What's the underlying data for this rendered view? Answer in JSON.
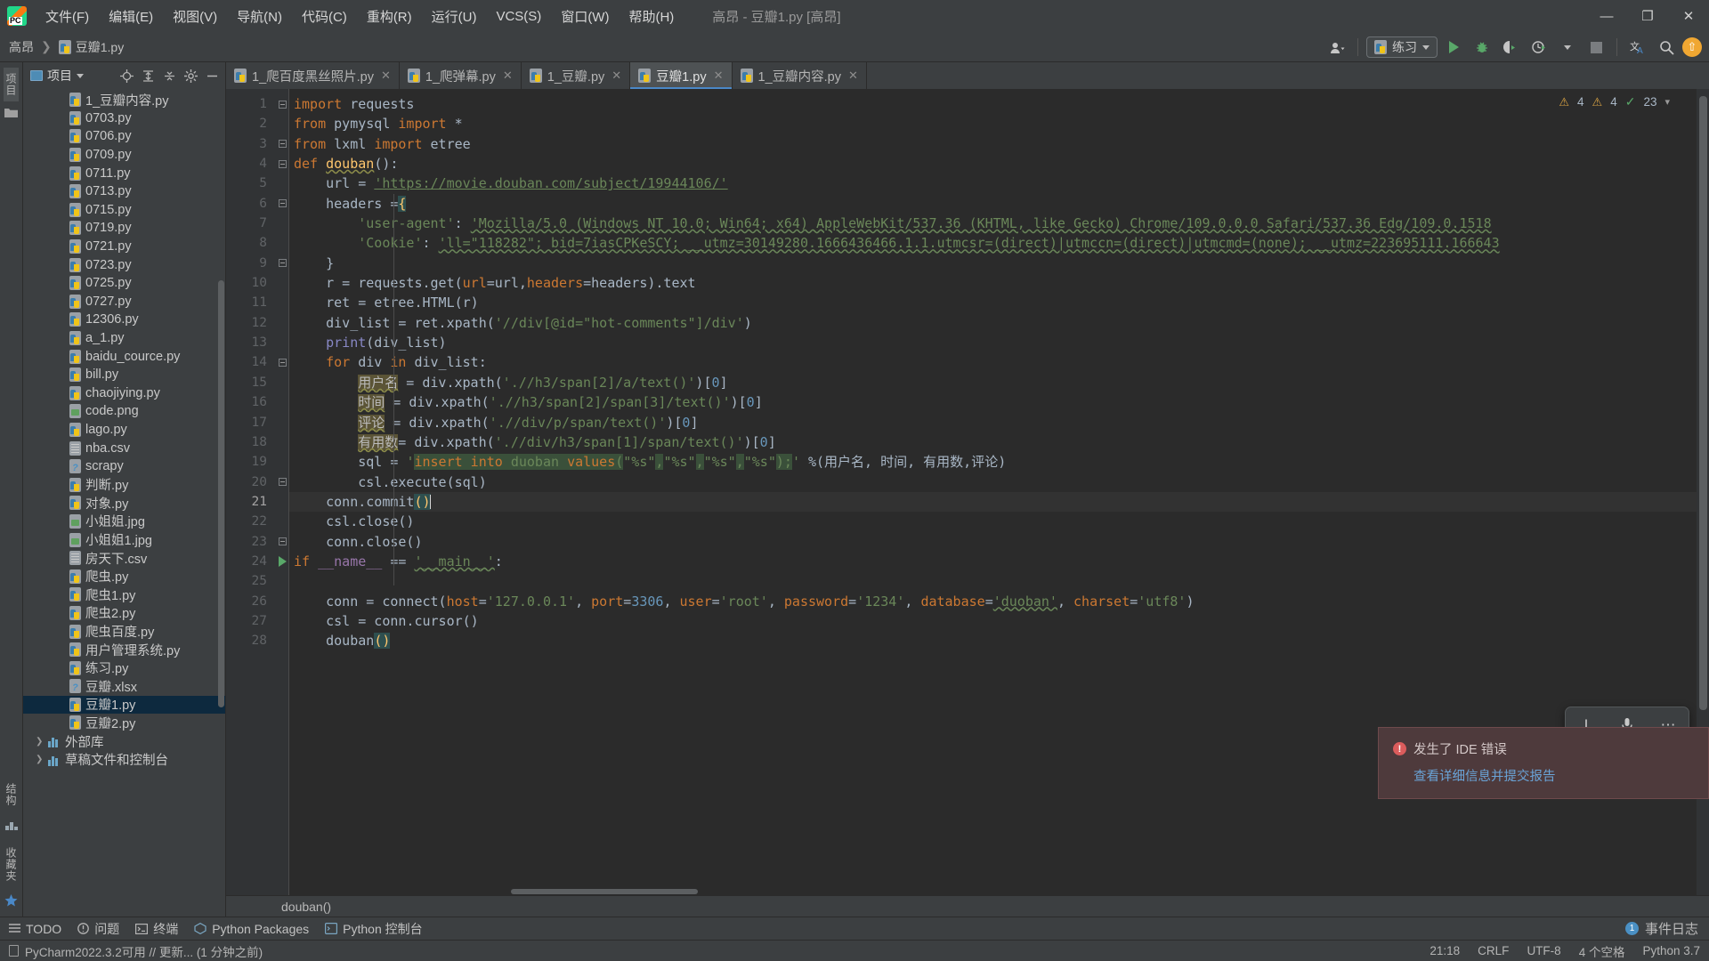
{
  "menu": {
    "items": [
      "文件(F)",
      "编辑(E)",
      "视图(V)",
      "导航(N)",
      "代码(C)",
      "重构(R)",
      "运行(U)",
      "VCS(S)",
      "窗口(W)",
      "帮助(H)"
    ],
    "window_title": "高昂 - 豆瓣1.py [高昂]",
    "controls": {
      "minimize": "—",
      "maximize": "❐",
      "close": "✕"
    }
  },
  "navbar": {
    "breadcrumb": {
      "project": "高昂",
      "file": "豆瓣1.py"
    },
    "run_config": "练习",
    "icons": {
      "account": "account-icon",
      "run": "run-icon",
      "debug": "debug-icon",
      "coverage": "coverage-icon",
      "profile": "profile-icon",
      "stop": "stop-icon",
      "translate": "translate-icon",
      "search": "search-icon",
      "update": "update-icon"
    }
  },
  "leftstrip": {
    "top_label": "项目",
    "bottom_labels": [
      "结构",
      "收藏夹"
    ]
  },
  "project_panel": {
    "title": "项目",
    "tools": [
      "locate-icon",
      "expand-icon",
      "collapse-icon",
      "settings-icon",
      "hide-icon"
    ],
    "tree": [
      {
        "label": "1_豆瓣内容.py",
        "type": "py",
        "selected": false
      },
      {
        "label": "0703.py",
        "type": "py",
        "selected": false
      },
      {
        "label": "0706.py",
        "type": "py",
        "selected": false
      },
      {
        "label": "0709.py",
        "type": "py",
        "selected": false
      },
      {
        "label": "0711.py",
        "type": "py",
        "selected": false
      },
      {
        "label": "0713.py",
        "type": "py",
        "selected": false
      },
      {
        "label": "0715.py",
        "type": "py",
        "selected": false
      },
      {
        "label": "0719.py",
        "type": "py",
        "selected": false
      },
      {
        "label": "0721.py",
        "type": "py",
        "selected": false
      },
      {
        "label": "0723.py",
        "type": "py",
        "selected": false
      },
      {
        "label": "0725.py",
        "type": "py",
        "selected": false
      },
      {
        "label": "0727.py",
        "type": "py",
        "selected": false
      },
      {
        "label": "12306.py",
        "type": "py",
        "selected": false
      },
      {
        "label": "a_1.py",
        "type": "py",
        "selected": false
      },
      {
        "label": "baidu_cource.py",
        "type": "py",
        "selected": false
      },
      {
        "label": "bill.py",
        "type": "py",
        "selected": false
      },
      {
        "label": "chaojiying.py",
        "type": "py",
        "selected": false
      },
      {
        "label": "code.png",
        "type": "img",
        "selected": false
      },
      {
        "label": "lago.py",
        "type": "py",
        "selected": false
      },
      {
        "label": "nba.csv",
        "type": "csv",
        "selected": false
      },
      {
        "label": "scrapy",
        "type": "unknown",
        "selected": false
      },
      {
        "label": "判断.py",
        "type": "py",
        "selected": false
      },
      {
        "label": "对象.py",
        "type": "py",
        "selected": false
      },
      {
        "label": "小姐姐.jpg",
        "type": "img",
        "selected": false
      },
      {
        "label": "小姐姐1.jpg",
        "type": "img",
        "selected": false
      },
      {
        "label": "房天下.csv",
        "type": "csv",
        "selected": false
      },
      {
        "label": "爬虫.py",
        "type": "py",
        "selected": false
      },
      {
        "label": "爬虫1.py",
        "type": "py",
        "selected": false
      },
      {
        "label": "爬虫2.py",
        "type": "py",
        "selected": false
      },
      {
        "label": "爬虫百度.py",
        "type": "py",
        "selected": false
      },
      {
        "label": "用户管理系统.py",
        "type": "py",
        "selected": false
      },
      {
        "label": "练习.py",
        "type": "py",
        "selected": false
      },
      {
        "label": "豆瓣.xlsx",
        "type": "unknown",
        "selected": false
      },
      {
        "label": "豆瓣1.py",
        "type": "py",
        "selected": true
      },
      {
        "label": "豆瓣2.py",
        "type": "py",
        "selected": false
      }
    ],
    "roots": [
      {
        "label": "外部库",
        "type": "lib"
      },
      {
        "label": "草稿文件和控制台",
        "type": "lib"
      }
    ]
  },
  "editor_tabs": [
    {
      "label": "1_爬百度黑丝照片.py",
      "active": false
    },
    {
      "label": "1_爬弹幕.py",
      "active": false
    },
    {
      "label": "1_豆瓣.py",
      "active": false
    },
    {
      "label": "豆瓣1.py",
      "active": true
    },
    {
      "label": "1_豆瓣内容.py",
      "active": false
    }
  ],
  "inspection": {
    "warnings_top": "4",
    "warnings_weak": "4",
    "checks": "23"
  },
  "code": {
    "line_count": 28,
    "current_line": 21,
    "lines": [
      "import requests",
      "from pymysql import *",
      "from lxml import etree",
      "def douban():",
      "    url = 'https://movie.douban.com/subject/19944106/'",
      "    headers ={",
      "        'user-agent': 'Mozilla/5.0 (Windows NT 10.0; Win64; x64) AppleWebKit/537.36 (KHTML, like Gecko) Chrome/109.0.0.0 Safari/537.36 Edg/109.0.1518",
      "        'Cookie': 'll=\"118282\"; bid=7iasCPKeSCY; __utmz=30149280.1666436466.1.1.utmcsr=(direct)|utmccn=(direct)|utmcmd=(none); __utmz=223695111.166643",
      "    }",
      "    r = requests.get(url=url,headers=headers).text",
      "    ret = etree.HTML(r)",
      "    div_list = ret.xpath('//div[@id=\"hot-comments\"]/div')",
      "    print(div_list)",
      "    for div in div_list:",
      "        用户名 = div.xpath('.//h3/span[2]/a/text()')[0]",
      "        时间 = div.xpath('.//h3/span[2]/span[3]/text()')[0]",
      "        评论 = div.xpath('.//div/p/span/text()')[0]",
      "        有用数= div.xpath('.//div/h3/span[1]/span/text()')[0]",
      "        sql = 'insert into duoban values(\"%s\",\"%s\",\"%s\",\"%s\");' %(用户名, 时间, 有用数,评论)",
      "        csl.execute(sql)",
      "    conn.commit()",
      "    csl.close()",
      "    conn.close()",
      "if __name__ == '__main__':",
      "",
      "    conn = connect(host='127.0.0.1', port=3306, user='root', password='1234', database='duoban', charset='utf8')",
      "    csl = conn.cursor()",
      "    douban()"
    ]
  },
  "editor_breadcrumb": "douban()",
  "ai_widget": {
    "icons": [
      "cursor-icon",
      "microphone-icon",
      "more-icon"
    ]
  },
  "error_balloon": {
    "title": "发生了 IDE 错误",
    "link": "查看详细信息并提交报告"
  },
  "toolwindows": {
    "items": [
      {
        "label": "TODO",
        "icon": "todo-icon"
      },
      {
        "label": "问题",
        "icon": "problems-icon"
      },
      {
        "label": "终端",
        "icon": "terminal-icon"
      },
      {
        "label": "Python Packages",
        "icon": "packages-icon"
      },
      {
        "label": "Python 控制台",
        "icon": "console-icon"
      }
    ],
    "right": {
      "count": "1",
      "label": "事件日志"
    }
  },
  "statusbar": {
    "left": "PyCharm2022.3.2可用 // 更新... (1 分钟之前)",
    "right": [
      "21:18",
      "CRLF",
      "UTF-8",
      "4 个空格",
      "Python 3.7"
    ]
  },
  "colors": {
    "accent": "#4a88c7",
    "run_green": "#59a869",
    "warn": "#d9a343",
    "error": "#db5c5c",
    "update": "#f0a732",
    "selection": "#0d293e"
  }
}
